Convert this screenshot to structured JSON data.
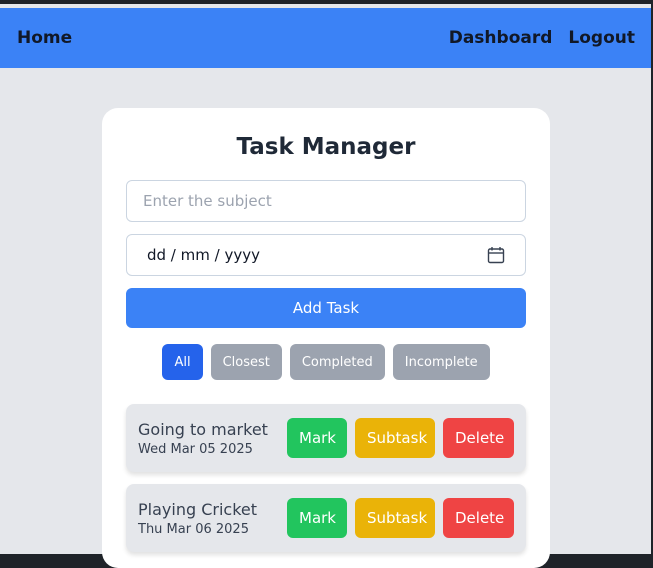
{
  "nav": {
    "home": "Home",
    "dashboard": "Dashboard",
    "logout": "Logout"
  },
  "card": {
    "title": "Task Manager",
    "subject_placeholder": "Enter the subject",
    "date_placeholder": "dd / mm / yyyy",
    "add_label": "Add Task"
  },
  "filters": [
    {
      "label": "All",
      "active": true
    },
    {
      "label": "Closest",
      "active": false
    },
    {
      "label": "Completed",
      "active": false
    },
    {
      "label": "Incomplete",
      "active": false
    }
  ],
  "tasks": [
    {
      "name": "Going to market",
      "date": "Wed Mar 05 2025"
    },
    {
      "name": "Playing Cricket",
      "date": "Thu Mar 06 2025"
    }
  ],
  "task_actions": {
    "mark": "Mark",
    "subtask": "Subtask",
    "delete": "Delete"
  },
  "colors": {
    "navbar": "#3b82f6",
    "primary": "#3b82f6",
    "active_filter": "#2563eb",
    "inactive_filter": "#9ca3af",
    "mark": "#22c55e",
    "subtask": "#eab308",
    "delete": "#ef4444"
  },
  "icons": {
    "date": "calendar-icon"
  }
}
